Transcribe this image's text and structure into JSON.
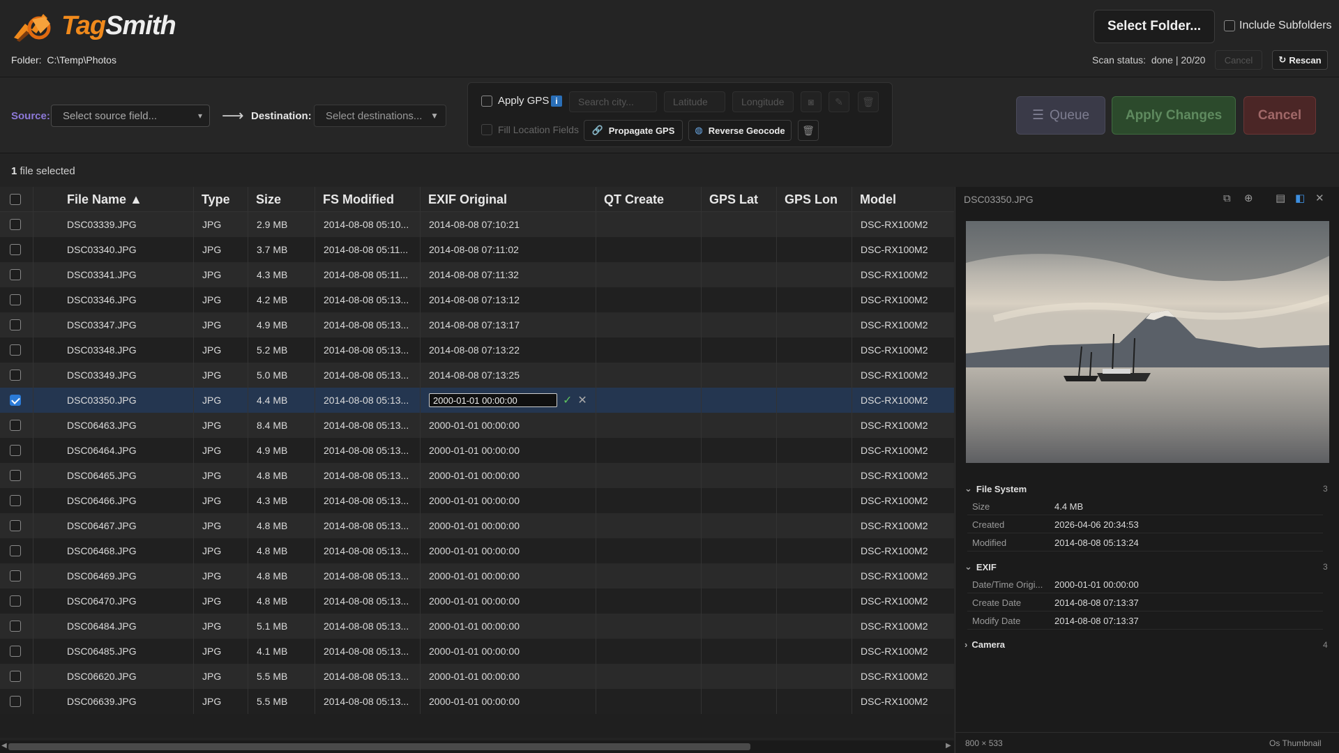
{
  "app": {
    "name_part1": "Tag",
    "name_part2": "Smith"
  },
  "header": {
    "folder_label": "Folder:",
    "folder_path": "C:\\Temp\\Photos",
    "select_folder_label": "Select Folder...",
    "include_subfolders_label": "Include Subfolders",
    "include_subfolders_checked": false,
    "scan_status_label": "Scan status:",
    "scan_status_value": "done | 20/20",
    "cancel_label": "Cancel",
    "rescan_label": "Rescan"
  },
  "toolbar": {
    "source_label": "Source:",
    "source_placeholder": "Select source field...",
    "destination_label": "Destination:",
    "destination_placeholder": "Select destinations...",
    "apply_gps_label": "Apply GPS",
    "info_glyph": "i",
    "city_placeholder": "Search city...",
    "latitude_placeholder": "Latitude",
    "longitude_placeholder": "Longitude",
    "fill_location_label": "Fill Location Fields",
    "propagate_gps_label": "Propagate GPS",
    "reverse_geocode_label": "Reverse Geocode",
    "queue_label": "Queue",
    "apply_changes_label": "Apply Changes",
    "cancel_label": "Cancel"
  },
  "selection": {
    "count": "1",
    "text": "file selected"
  },
  "table": {
    "columns": [
      "File Name",
      "Type",
      "Size",
      "FS Modified",
      "EXIF Original",
      "QT Create",
      "GPS Lat",
      "GPS Lon",
      "Model"
    ],
    "sort_indicator": "▲",
    "rows": [
      {
        "name": "DSC03339.JPG",
        "type": "JPG",
        "size": "2.9 MB",
        "fs": "2014-08-08 05:10...",
        "exif": "2014-08-08 07:10:21",
        "qt": "",
        "lat": "",
        "lon": "",
        "model": "DSC-RX100M2",
        "checked": false
      },
      {
        "name": "DSC03340.JPG",
        "type": "JPG",
        "size": "3.7 MB",
        "fs": "2014-08-08 05:11...",
        "exif": "2014-08-08 07:11:02",
        "qt": "",
        "lat": "",
        "lon": "",
        "model": "DSC-RX100M2",
        "checked": false
      },
      {
        "name": "DSC03341.JPG",
        "type": "JPG",
        "size": "4.3 MB",
        "fs": "2014-08-08 05:11...",
        "exif": "2014-08-08 07:11:32",
        "qt": "",
        "lat": "",
        "lon": "",
        "model": "DSC-RX100M2",
        "checked": false
      },
      {
        "name": "DSC03346.JPG",
        "type": "JPG",
        "size": "4.2 MB",
        "fs": "2014-08-08 05:13...",
        "exif": "2014-08-08 07:13:12",
        "qt": "",
        "lat": "",
        "lon": "",
        "model": "DSC-RX100M2",
        "checked": false
      },
      {
        "name": "DSC03347.JPG",
        "type": "JPG",
        "size": "4.9 MB",
        "fs": "2014-08-08 05:13...",
        "exif": "2014-08-08 07:13:17",
        "qt": "",
        "lat": "",
        "lon": "",
        "model": "DSC-RX100M2",
        "checked": false
      },
      {
        "name": "DSC03348.JPG",
        "type": "JPG",
        "size": "5.2 MB",
        "fs": "2014-08-08 05:13...",
        "exif": "2014-08-08 07:13:22",
        "qt": "",
        "lat": "",
        "lon": "",
        "model": "DSC-RX100M2",
        "checked": false
      },
      {
        "name": "DSC03349.JPG",
        "type": "JPG",
        "size": "5.0 MB",
        "fs": "2014-08-08 05:13...",
        "exif": "2014-08-08 07:13:25",
        "qt": "",
        "lat": "",
        "lon": "",
        "model": "DSC-RX100M2",
        "checked": false
      },
      {
        "name": "DSC03350.JPG",
        "type": "JPG",
        "size": "4.4 MB",
        "fs": "2014-08-08 05:13...",
        "exif": "2000-01-01 00:00:00",
        "qt": "",
        "lat": "",
        "lon": "",
        "model": "DSC-RX100M2",
        "checked": true,
        "editing": true
      },
      {
        "name": "DSC06463.JPG",
        "type": "JPG",
        "size": "8.4 MB",
        "fs": "2014-08-08 05:13...",
        "exif": "2000-01-01 00:00:00",
        "qt": "",
        "lat": "",
        "lon": "",
        "model": "DSC-RX100M2",
        "checked": false
      },
      {
        "name": "DSC06464.JPG",
        "type": "JPG",
        "size": "4.9 MB",
        "fs": "2014-08-08 05:13...",
        "exif": "2000-01-01 00:00:00",
        "qt": "",
        "lat": "",
        "lon": "",
        "model": "DSC-RX100M2",
        "checked": false
      },
      {
        "name": "DSC06465.JPG",
        "type": "JPG",
        "size": "4.8 MB",
        "fs": "2014-08-08 05:13...",
        "exif": "2000-01-01 00:00:00",
        "qt": "",
        "lat": "",
        "lon": "",
        "model": "DSC-RX100M2",
        "checked": false
      },
      {
        "name": "DSC06466.JPG",
        "type": "JPG",
        "size": "4.3 MB",
        "fs": "2014-08-08 05:13...",
        "exif": "2000-01-01 00:00:00",
        "qt": "",
        "lat": "",
        "lon": "",
        "model": "DSC-RX100M2",
        "checked": false
      },
      {
        "name": "DSC06467.JPG",
        "type": "JPG",
        "size": "4.8 MB",
        "fs": "2014-08-08 05:13...",
        "exif": "2000-01-01 00:00:00",
        "qt": "",
        "lat": "",
        "lon": "",
        "model": "DSC-RX100M2",
        "checked": false
      },
      {
        "name": "DSC06468.JPG",
        "type": "JPG",
        "size": "4.8 MB",
        "fs": "2014-08-08 05:13...",
        "exif": "2000-01-01 00:00:00",
        "qt": "",
        "lat": "",
        "lon": "",
        "model": "DSC-RX100M2",
        "checked": false
      },
      {
        "name": "DSC06469.JPG",
        "type": "JPG",
        "size": "4.8 MB",
        "fs": "2014-08-08 05:13...",
        "exif": "2000-01-01 00:00:00",
        "qt": "",
        "lat": "",
        "lon": "",
        "model": "DSC-RX100M2",
        "checked": false
      },
      {
        "name": "DSC06470.JPG",
        "type": "JPG",
        "size": "4.8 MB",
        "fs": "2014-08-08 05:13...",
        "exif": "2000-01-01 00:00:00",
        "qt": "",
        "lat": "",
        "lon": "",
        "model": "DSC-RX100M2",
        "checked": false
      },
      {
        "name": "DSC06484.JPG",
        "type": "JPG",
        "size": "5.1 MB",
        "fs": "2014-08-08 05:13...",
        "exif": "2000-01-01 00:00:00",
        "qt": "",
        "lat": "",
        "lon": "",
        "model": "DSC-RX100M2",
        "checked": false
      },
      {
        "name": "DSC06485.JPG",
        "type": "JPG",
        "size": "4.1 MB",
        "fs": "2014-08-08 05:13...",
        "exif": "2000-01-01 00:00:00",
        "qt": "",
        "lat": "",
        "lon": "",
        "model": "DSC-RX100M2",
        "checked": false
      },
      {
        "name": "DSC06620.JPG",
        "type": "JPG",
        "size": "5.5 MB",
        "fs": "2014-08-08 05:13...",
        "exif": "2000-01-01 00:00:00",
        "qt": "",
        "lat": "",
        "lon": "",
        "model": "DSC-RX100M2",
        "checked": false
      },
      {
        "name": "DSC06639.JPG",
        "type": "JPG",
        "size": "5.5 MB",
        "fs": "2014-08-08 05:13...",
        "exif": "2000-01-01 00:00:00",
        "qt": "",
        "lat": "",
        "lon": "",
        "model": "DSC-RX100M2",
        "checked": false
      }
    ]
  },
  "panel": {
    "title": "DSC03350.JPG",
    "sections": [
      {
        "name": "File System",
        "count": "3",
        "expanded": true,
        "items": [
          {
            "key": "Size",
            "value": "4.4 MB"
          },
          {
            "key": "Created",
            "value": "2026-04-06 20:34:53"
          },
          {
            "key": "Modified",
            "value": "2014-08-08 05:13:24"
          }
        ]
      },
      {
        "name": "EXIF",
        "count": "3",
        "expanded": true,
        "items": [
          {
            "key": "Date/Time Origi...",
            "value": "2000-01-01 00:00:00"
          },
          {
            "key": "Create Date",
            "value": "2014-08-08 07:13:37"
          },
          {
            "key": "Modify Date",
            "value": "2014-08-08 07:13:37"
          }
        ]
      },
      {
        "name": "Camera",
        "count": "4",
        "expanded": false,
        "items": []
      }
    ],
    "dimensions": "800 × 533",
    "thumb_source": "Os Thumbnail"
  },
  "icons": {
    "logo": "tagsmith-logo-icon",
    "rescan": "refresh-icon",
    "external": "external-link-icon",
    "zoom": "zoom-icon",
    "layout_h": "layout-horizontal-icon",
    "layout_v": "layout-vertical-icon",
    "close": "close-icon",
    "queue": "queue-icon",
    "link": "link-icon",
    "globe": "globe-icon",
    "trash": "trash-icon",
    "camera": "camera-icon",
    "pencil": "pencil-icon"
  },
  "colors": {
    "accent": "#2b7bd8",
    "logo_orange": "#f08a1c",
    "source_label": "#8d79d8",
    "selected_row": "#243650"
  }
}
